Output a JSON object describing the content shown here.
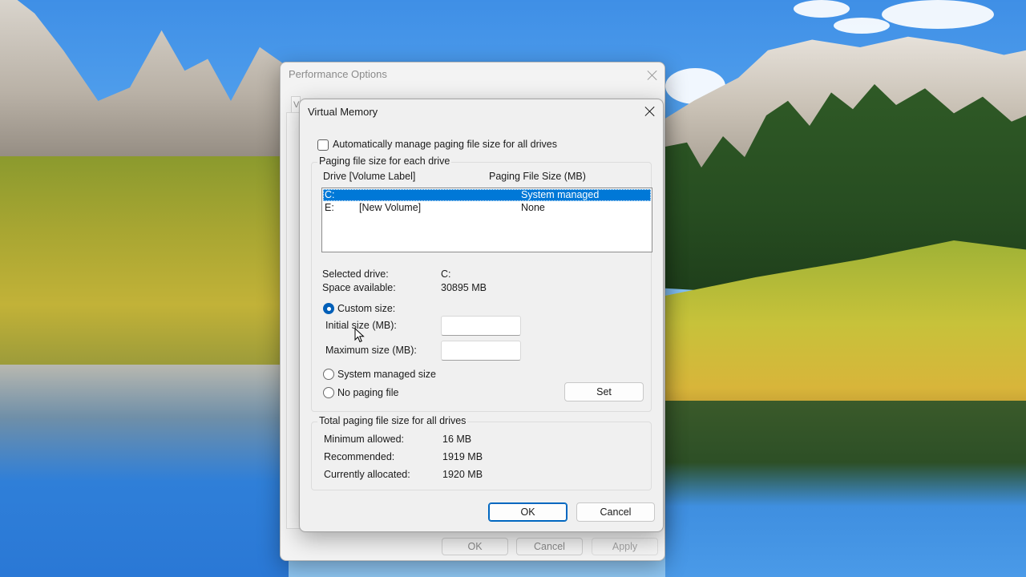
{
  "background_window": {
    "title": "Performance Options",
    "tab_stub": "Vi",
    "buttons": {
      "ok": "OK",
      "cancel": "Cancel",
      "apply": "Apply"
    }
  },
  "dialog": {
    "title": "Virtual Memory",
    "auto_manage_label": "Automatically manage paging file size for all drives",
    "auto_manage_checked": false,
    "paging_group": {
      "legend": "Paging file size for each drive",
      "col_drive": "Drive  [Volume Label]",
      "col_size": "Paging File Size (MB)",
      "rows": [
        {
          "drive": "C:",
          "label": "",
          "size": "System managed",
          "selected": true
        },
        {
          "drive": "E:",
          "label": "[New Volume]",
          "size": "None",
          "selected": false
        }
      ]
    },
    "selected_drive_label": "Selected drive:",
    "selected_drive_value": "C:",
    "space_available_label": "Space available:",
    "space_available_value": "30895 MB",
    "custom_size_label": "Custom size:",
    "initial_size_label": "Initial size (MB):",
    "initial_size_value": "",
    "maximum_size_label": "Maximum size (MB):",
    "maximum_size_value": "",
    "system_managed_label": "System managed size",
    "no_paging_label": "No paging file",
    "selected_option": "custom",
    "set_button": "Set",
    "totals_group": {
      "legend": "Total paging file size for all drives",
      "minimum_label": "Minimum allowed:",
      "minimum_value": "16 MB",
      "recommended_label": "Recommended:",
      "recommended_value": "1919 MB",
      "allocated_label": "Currently allocated:",
      "allocated_value": "1920 MB"
    },
    "ok_button": "OK",
    "cancel_button": "Cancel"
  },
  "colors": {
    "selection_blue": "#0078d7",
    "accent_blue": "#0067c0"
  }
}
